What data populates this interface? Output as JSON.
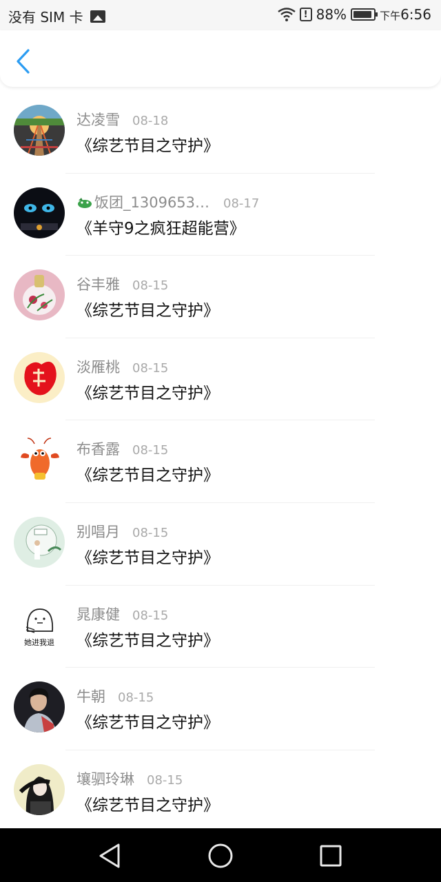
{
  "status_bar": {
    "carrier": "没有 SIM 卡",
    "battery": "88%",
    "time_prefix": "下午",
    "time": "6:56"
  },
  "header": {
    "back_icon": "chevron-left-icon",
    "accent": "#2b9cf2"
  },
  "items": [
    {
      "name": "达凌雪",
      "date": "08-18",
      "title": "《综艺节目之守护》"
    },
    {
      "name": "饭团_13096532...",
      "date": "08-17",
      "title": "《羊守9之疯狂超能营》"
    },
    {
      "name": "谷丰雅",
      "date": "08-15",
      "title": "《综艺节目之守护》"
    },
    {
      "name": "淡雁桃",
      "date": "08-15",
      "title": "《综艺节目之守护》"
    },
    {
      "name": "布香露",
      "date": "08-15",
      "title": "《综艺节目之守护》"
    },
    {
      "name": "别唱月",
      "date": "08-15",
      "title": "《综艺节目之守护》"
    },
    {
      "name": "晁康健",
      "date": "08-15",
      "title": "《综艺节目之守护》"
    },
    {
      "name": "牛朝",
      "date": "08-15",
      "title": "《综艺节目之守护》"
    },
    {
      "name": "壤驷玲琳",
      "date": "08-15",
      "title": "《综艺节目之守护》"
    }
  ],
  "avatar_logo_text": {
    "avatar_6": "她进我退"
  },
  "nav": {
    "back_icon": "triangle-back-icon",
    "home_icon": "circle-home-icon",
    "recents_icon": "square-recents-icon"
  }
}
